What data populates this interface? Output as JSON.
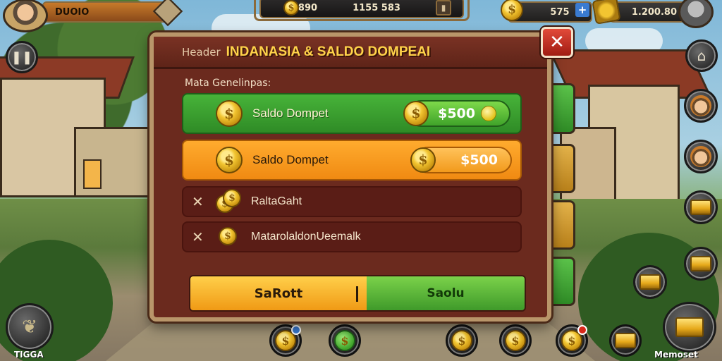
{
  "hud": {
    "player_name": "DUOIO",
    "resource_label": "M890",
    "resource_value": "1155 583",
    "gold_value": "575",
    "gem_value": "1.200.80"
  },
  "dialog": {
    "header_small": "Header",
    "title": "INDANASIA & SALDO DOMPEAI",
    "subtitle": "Mata Genelinpas:",
    "close_symbol": "✕",
    "rows": [
      {
        "label": "Saldo Dompet",
        "value": "$500"
      },
      {
        "label": "Saldo Dompet",
        "value": "$500"
      },
      {
        "label": "RaltaGaht"
      },
      {
        "label": "MatarolaldonUeemalk"
      }
    ],
    "button_left": "SaRott",
    "button_right": "Saolu"
  },
  "bottom": {
    "left_label": "TIGGA",
    "right_label": "Memoset"
  },
  "colors": {
    "dialog_bg": "#6b2a1e",
    "title": "#ffd34a",
    "green": "#3fa32a",
    "orange": "#f29a1c",
    "close": "#c12b1d"
  }
}
